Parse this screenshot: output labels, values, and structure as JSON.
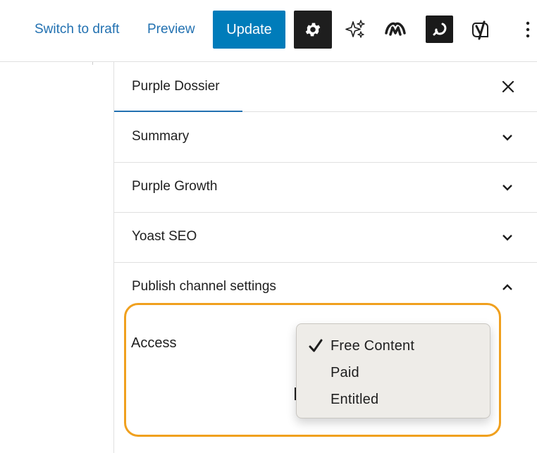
{
  "topbar": {
    "switch_draft": "Switch to draft",
    "preview": "Preview",
    "update": "Update",
    "icons": [
      "gear-icon",
      "sparkles-icon",
      "w-logo-icon",
      "j-logo-icon",
      "yoast-icon",
      "more-vertical-icon"
    ]
  },
  "sidebar": {
    "tab": "Purple Dossier",
    "panels": [
      {
        "title": "Summary",
        "state": "collapsed"
      },
      {
        "title": "Purple Growth",
        "state": "collapsed"
      },
      {
        "title": "Yoast SEO",
        "state": "collapsed"
      },
      {
        "title": "Publish channel settings",
        "state": "expanded"
      }
    ]
  },
  "publish_settings": {
    "access_label": "Access",
    "options": [
      "Free Content",
      "Paid",
      "Entitled"
    ],
    "selected": "Free Content"
  },
  "colors": {
    "accent": "#007cba",
    "link": "#2271b1",
    "highlight": "#f0a01e"
  }
}
